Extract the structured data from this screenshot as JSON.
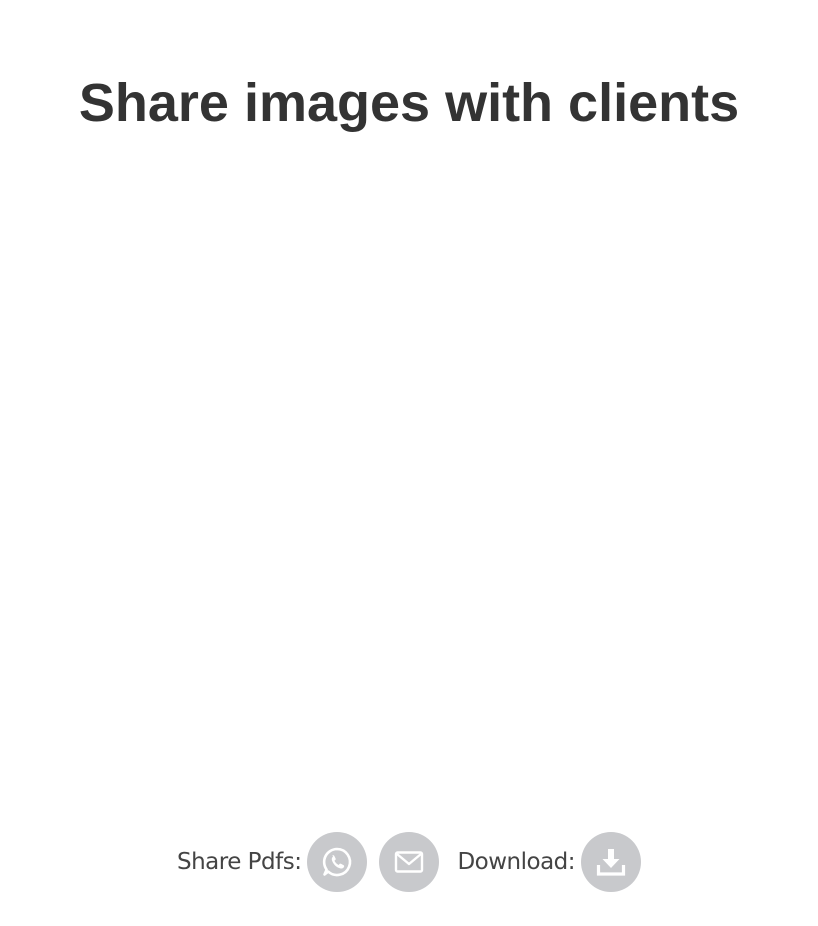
{
  "page": {
    "title": "Share images with clients"
  },
  "share": {
    "label": "Share Pdfs:",
    "buttons": [
      {
        "icon": "whatsapp-icon"
      },
      {
        "icon": "mail-icon"
      }
    ]
  },
  "download": {
    "label": "Download:",
    "icon": "download-icon"
  },
  "colors": {
    "title_text": "#333333",
    "label_text": "#444444",
    "icon_circle": "#c8c9cc",
    "icon_glyph": "#ffffff"
  }
}
